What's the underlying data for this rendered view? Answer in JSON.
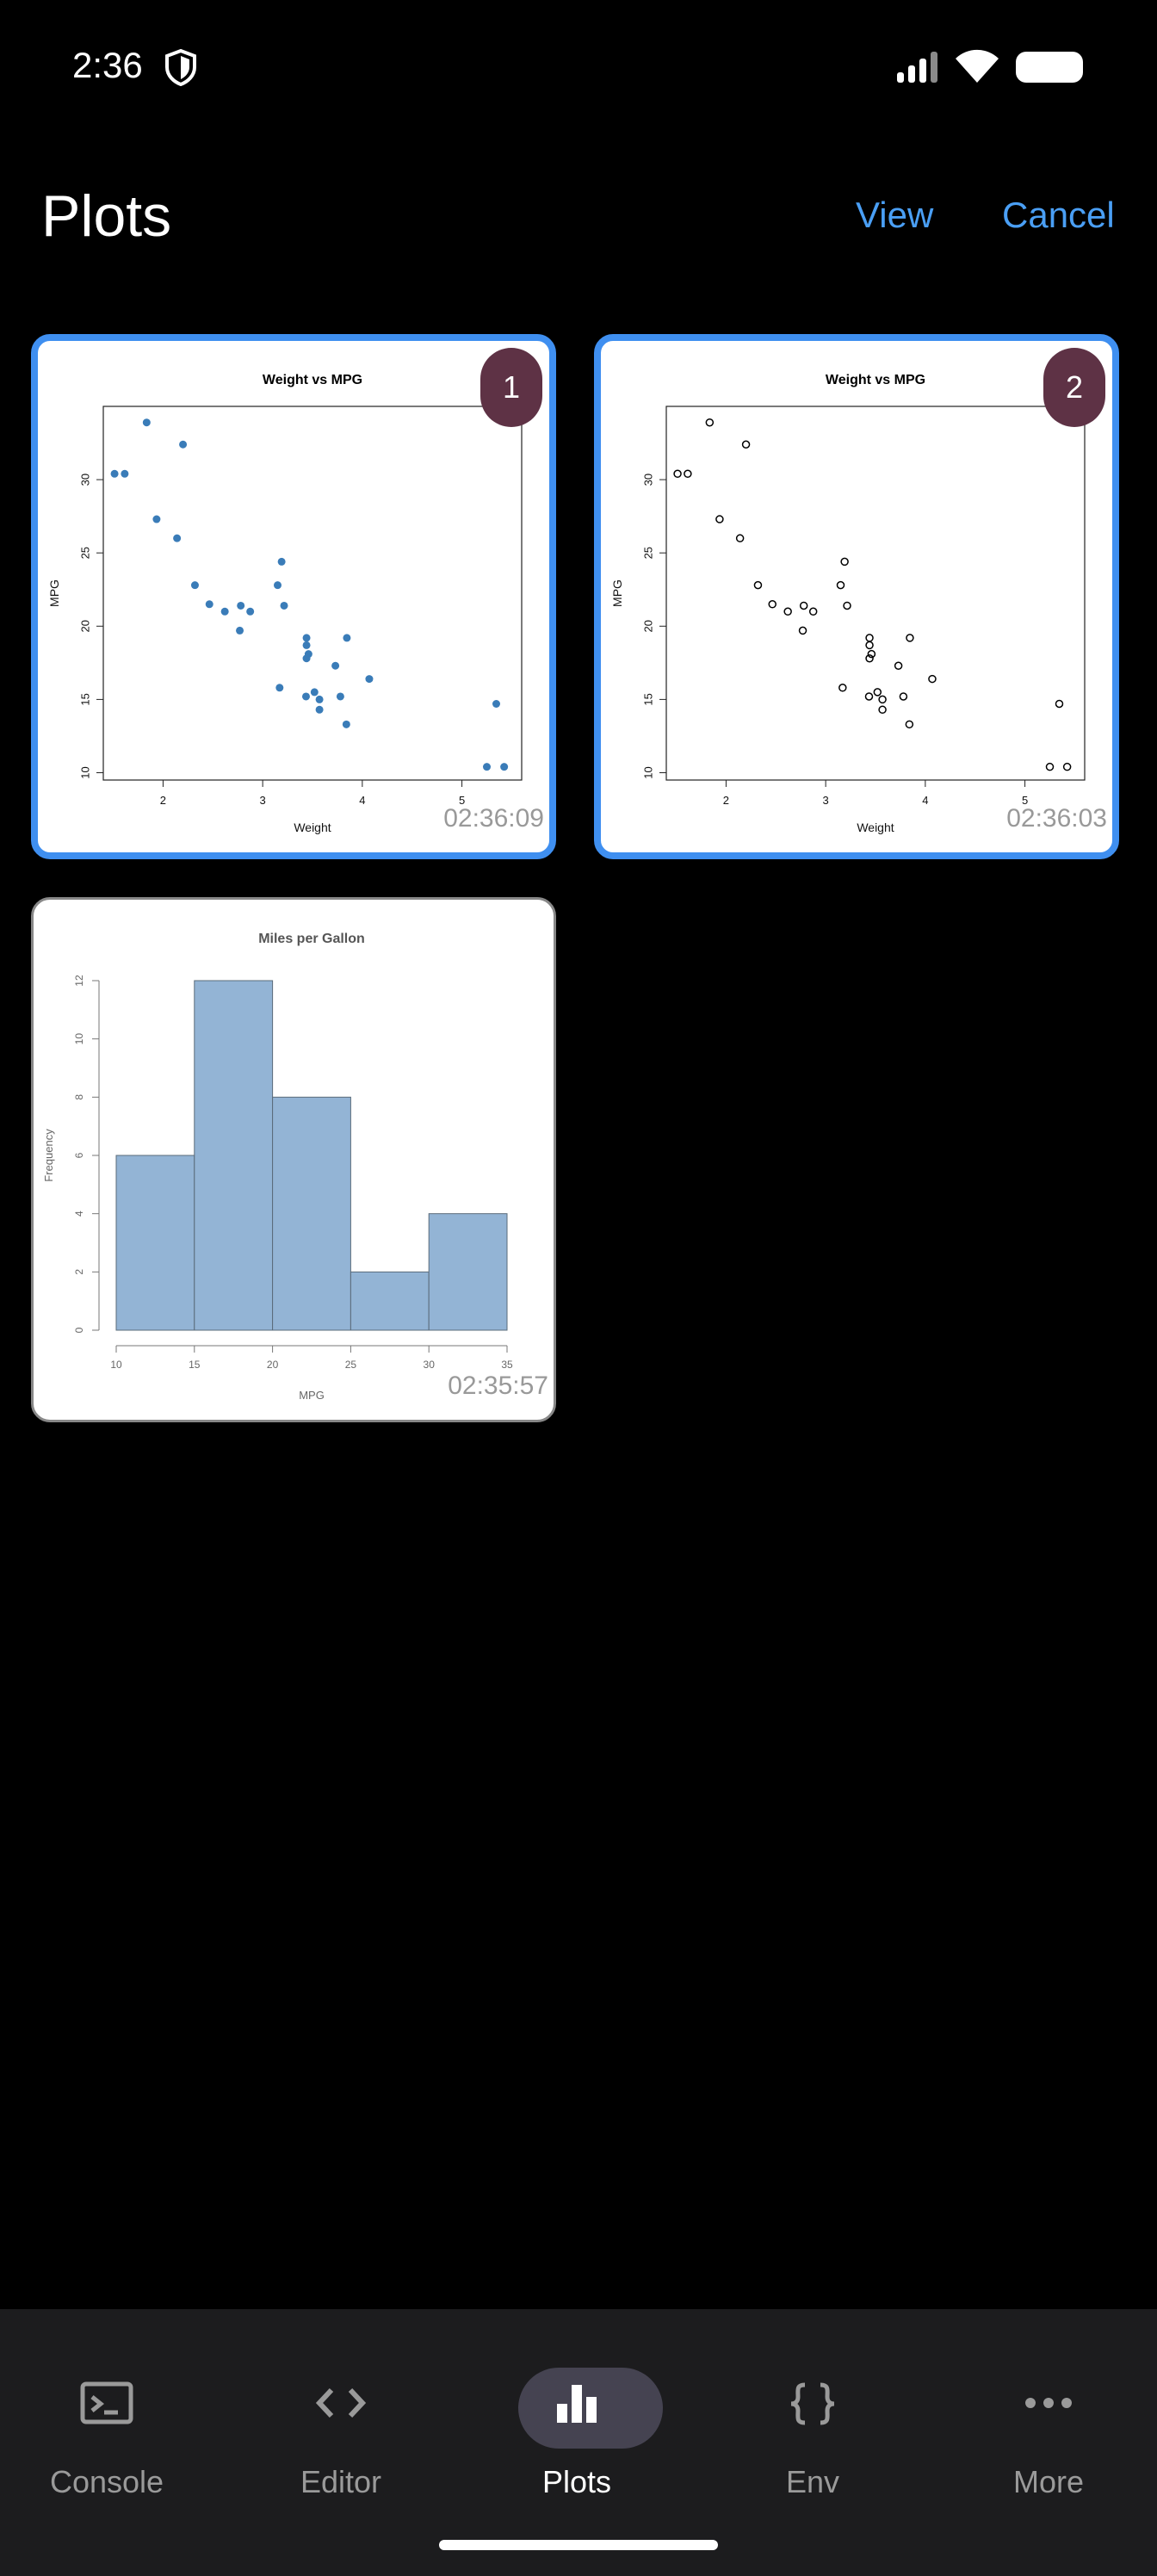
{
  "status_bar": {
    "time": "2:36"
  },
  "header": {
    "title": "Plots",
    "view_label": "View",
    "cancel_label": "Cancel"
  },
  "plots": [
    {
      "badge": "1",
      "timestamp": "02:36:09",
      "selected": true,
      "chart_data": {
        "type": "scatter",
        "title": "Weight vs MPG",
        "xlabel": "Weight",
        "ylabel": "MPG",
        "xlim": [
          1.4,
          5.6
        ],
        "ylim": [
          9.5,
          35
        ],
        "xticks": [
          2,
          3,
          4,
          5
        ],
        "yticks": [
          10,
          15,
          20,
          25,
          30
        ],
        "point_style": "filled",
        "point_color": "#3a7cb8",
        "series": [
          {
            "x": [
              2.62,
              2.875,
              2.32,
              3.215,
              3.44,
              3.46,
              3.57,
              3.19,
              3.15,
              3.44,
              3.44,
              4.07,
              3.73,
              3.78,
              5.25,
              5.424,
              5.345,
              2.2,
              1.615,
              1.835,
              2.465,
              3.52,
              3.435,
              3.84,
              3.845,
              1.935,
              2.14,
              1.513,
              3.17,
              2.77,
              3.57,
              2.78
            ],
            "y": [
              21,
              21,
              22.8,
              21.4,
              18.7,
              18.1,
              14.3,
              24.4,
              22.8,
              19.2,
              17.8,
              16.4,
              17.3,
              15.2,
              10.4,
              10.4,
              14.7,
              32.4,
              30.4,
              33.9,
              21.5,
              15.5,
              15.2,
              13.3,
              19.2,
              27.3,
              26,
              30.4,
              15.8,
              19.7,
              15,
              21.4
            ]
          }
        ]
      }
    },
    {
      "badge": "2",
      "timestamp": "02:36:03",
      "selected": true,
      "chart_data": {
        "type": "scatter",
        "title": "Weight vs MPG",
        "xlabel": "Weight",
        "ylabel": "MPG",
        "xlim": [
          1.4,
          5.6
        ],
        "ylim": [
          9.5,
          35
        ],
        "xticks": [
          2,
          3,
          4,
          5
        ],
        "yticks": [
          10,
          15,
          20,
          25,
          30
        ],
        "point_style": "open",
        "point_color": "#000000",
        "series": [
          {
            "x": [
              2.62,
              2.875,
              2.32,
              3.215,
              3.44,
              3.46,
              3.57,
              3.19,
              3.15,
              3.44,
              3.44,
              4.07,
              3.73,
              3.78,
              5.25,
              5.424,
              5.345,
              2.2,
              1.615,
              1.835,
              2.465,
              3.52,
              3.435,
              3.84,
              3.845,
              1.935,
              2.14,
              1.513,
              3.17,
              2.77,
              3.57,
              2.78
            ],
            "y": [
              21,
              21,
              22.8,
              21.4,
              18.7,
              18.1,
              14.3,
              24.4,
              22.8,
              19.2,
              17.8,
              16.4,
              17.3,
              15.2,
              10.4,
              10.4,
              14.7,
              32.4,
              30.4,
              33.9,
              21.5,
              15.5,
              15.2,
              13.3,
              19.2,
              27.3,
              26,
              30.4,
              15.8,
              19.7,
              15,
              21.4
            ]
          }
        ]
      }
    },
    {
      "badge": "",
      "timestamp": "02:35:57",
      "selected": false,
      "chart_data": {
        "type": "bar",
        "title": "Miles per Gallon",
        "xlabel": "MPG",
        "ylabel": "Frequency",
        "bins": [
          [
            10,
            15
          ],
          [
            15,
            20
          ],
          [
            20,
            25
          ],
          [
            25,
            30
          ],
          [
            30,
            35
          ]
        ],
        "values": [
          6,
          12,
          8,
          2,
          4
        ],
        "xticks": [
          10,
          15,
          20,
          25,
          30,
          35
        ],
        "yticks": [
          0,
          2,
          4,
          6,
          8,
          10,
          12
        ],
        "ylim": [
          0,
          12
        ],
        "bar_color": "#93b4d5"
      }
    }
  ],
  "nav": {
    "items": [
      {
        "label": "Console",
        "icon": "terminal-icon"
      },
      {
        "label": "Editor",
        "icon": "code-icon"
      },
      {
        "label": "Plots",
        "icon": "bar-chart-icon",
        "active": true
      },
      {
        "label": "Env",
        "icon": "braces-icon"
      },
      {
        "label": "More",
        "icon": "more-dots-icon"
      }
    ]
  }
}
